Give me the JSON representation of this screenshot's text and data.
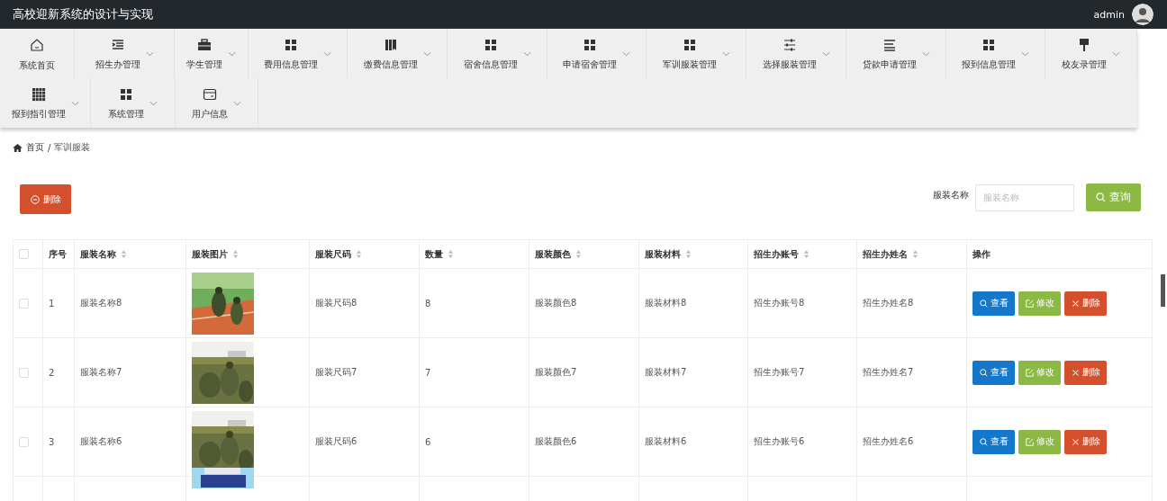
{
  "header": {
    "title": "高校迎新系统的设计与实现",
    "user": "admin"
  },
  "nav": [
    {
      "label": "系统首页",
      "dropdown": false
    },
    {
      "label": "招生办管理",
      "dropdown": true
    },
    {
      "label": "学生管理",
      "dropdown": true
    },
    {
      "label": "费用信息管理",
      "dropdown": true
    },
    {
      "label": "缴费信息管理",
      "dropdown": true
    },
    {
      "label": "宿舍信息管理",
      "dropdown": true
    },
    {
      "label": "申请宿舍管理",
      "dropdown": true
    },
    {
      "label": "军训服装管理",
      "dropdown": true
    },
    {
      "label": "选择服装管理",
      "dropdown": true
    },
    {
      "label": "贷款申请管理",
      "dropdown": true
    },
    {
      "label": "报到信息管理",
      "dropdown": true
    },
    {
      "label": "校友录管理",
      "dropdown": true
    },
    {
      "label": "报到指引管理",
      "dropdown": true
    },
    {
      "label": "系统管理",
      "dropdown": true
    },
    {
      "label": "用户信息",
      "dropdown": true
    }
  ],
  "breadcrumb": {
    "items": [
      "首页",
      "军训服装"
    ],
    "separator": "/"
  },
  "toolbar": {
    "delete_button": "删除",
    "search_label": "服装名称",
    "search_placeholder": "服装名称",
    "search_button": "查询"
  },
  "table": {
    "select_all_checked": false,
    "columns": [
      {
        "label": "序号",
        "sortable": false
      },
      {
        "label": "服装名称",
        "sortable": true
      },
      {
        "label": "服装图片",
        "sortable": true
      },
      {
        "label": "服装尺码",
        "sortable": true
      },
      {
        "label": "数量",
        "sortable": true
      },
      {
        "label": "服装颜色",
        "sortable": true
      },
      {
        "label": "服装材料",
        "sortable": true
      },
      {
        "label": "招生办账号",
        "sortable": true
      },
      {
        "label": "招生办姓名",
        "sortable": true
      },
      {
        "label": "操作",
        "sortable": false
      }
    ],
    "rows": [
      {
        "checked": false,
        "cells": [
          "1",
          "服装名称8",
          "服装尺码8",
          "8",
          "服装颜色8",
          "服装材料8",
          "招生办账号8",
          "招生办姓名8"
        ],
        "actions": [
          "查看",
          "修改",
          "删除"
        ]
      },
      {
        "checked": false,
        "cells": [
          "2",
          "服装名称7",
          "服装尺码7",
          "7",
          "服装颜色7",
          "服装材料7",
          "招生办账号7",
          "招生办姓名7"
        ],
        "actions": [
          "查看",
          "修改",
          "删除"
        ]
      },
      {
        "checked": false,
        "cells": [
          "3",
          "服装名称6",
          "服装尺码6",
          "6",
          "服装颜色6",
          "服装材料6",
          "招生办账号6",
          "招生办姓名6"
        ],
        "actions": [
          "查看",
          "修改",
          "删除"
        ]
      },
      {
        "kind": "partial"
      }
    ]
  }
}
